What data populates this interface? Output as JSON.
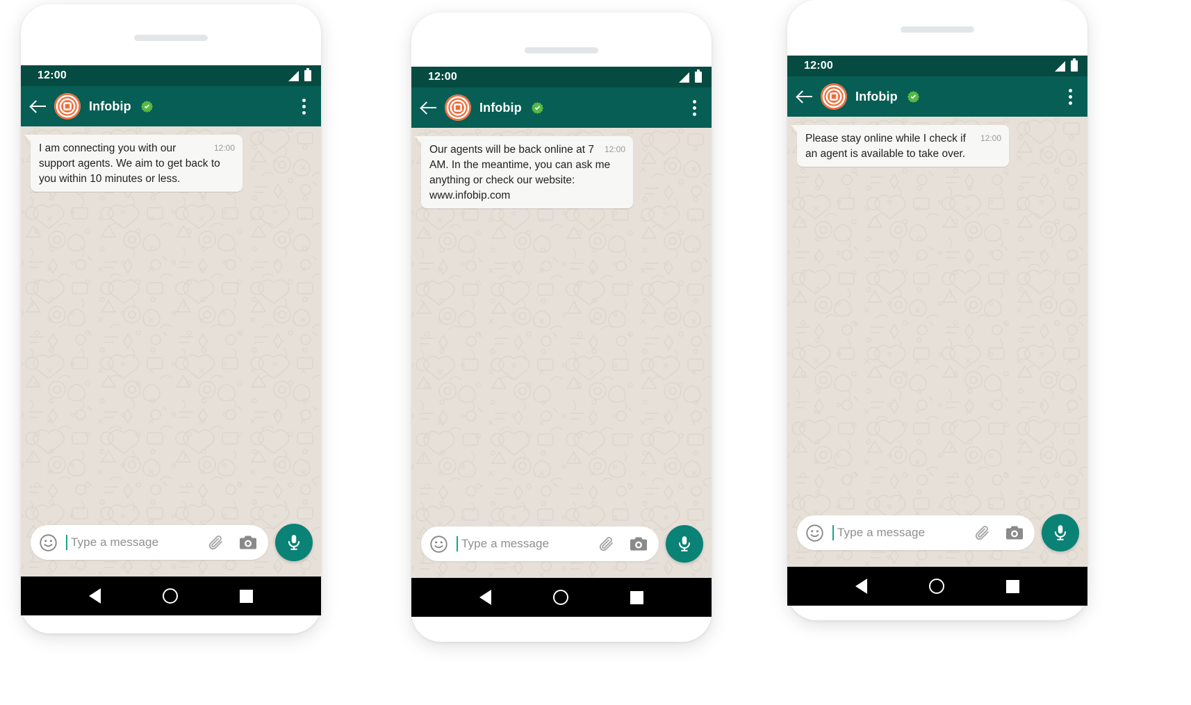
{
  "app": {
    "name": "WhatsApp Business chat",
    "brand_color": "#075e54",
    "statusbar_color": "#064b41",
    "accent_color": "#0b8276",
    "chat_background": "#e6e0d8",
    "bubble_color": "#f7f7f5",
    "logo_color": "#f26b38",
    "verified_color": "#57b945"
  },
  "status": {
    "time": "12:00",
    "signal_icon": "signal-bars-icon",
    "battery_icon": "battery-icon"
  },
  "header": {
    "back_icon": "back-arrow-icon",
    "avatar_icon": "infobip-logo-avatar",
    "contact_name": "Infobip",
    "verified_icon": "verified-badge-icon",
    "menu_icon": "overflow-menu-icon"
  },
  "composer": {
    "emoji_icon": "emoji-smiley-icon",
    "placeholder": "Type a message",
    "value": "",
    "attach_icon": "paperclip-icon",
    "camera_icon": "camera-icon",
    "mic_icon": "microphone-icon"
  },
  "navbar": {
    "back_icon": "nav-back-icon",
    "home_icon": "nav-home-icon",
    "recents_icon": "nav-recents-icon"
  },
  "phones": [
    {
      "id": "phone-1",
      "message": {
        "text": "I am connecting you with our support agents. We aim to get back to you within 10 minutes or less.",
        "time": "12:00"
      }
    },
    {
      "id": "phone-2",
      "message": {
        "text": "Our agents will be back online at 7 AM. In the meantime, you can ask me anything or check our website: www.infobip.com",
        "time": "12:00"
      }
    },
    {
      "id": "phone-3",
      "message": {
        "text": "Please stay online while I check if an agent is available to take over.",
        "time": "12:00"
      }
    }
  ]
}
